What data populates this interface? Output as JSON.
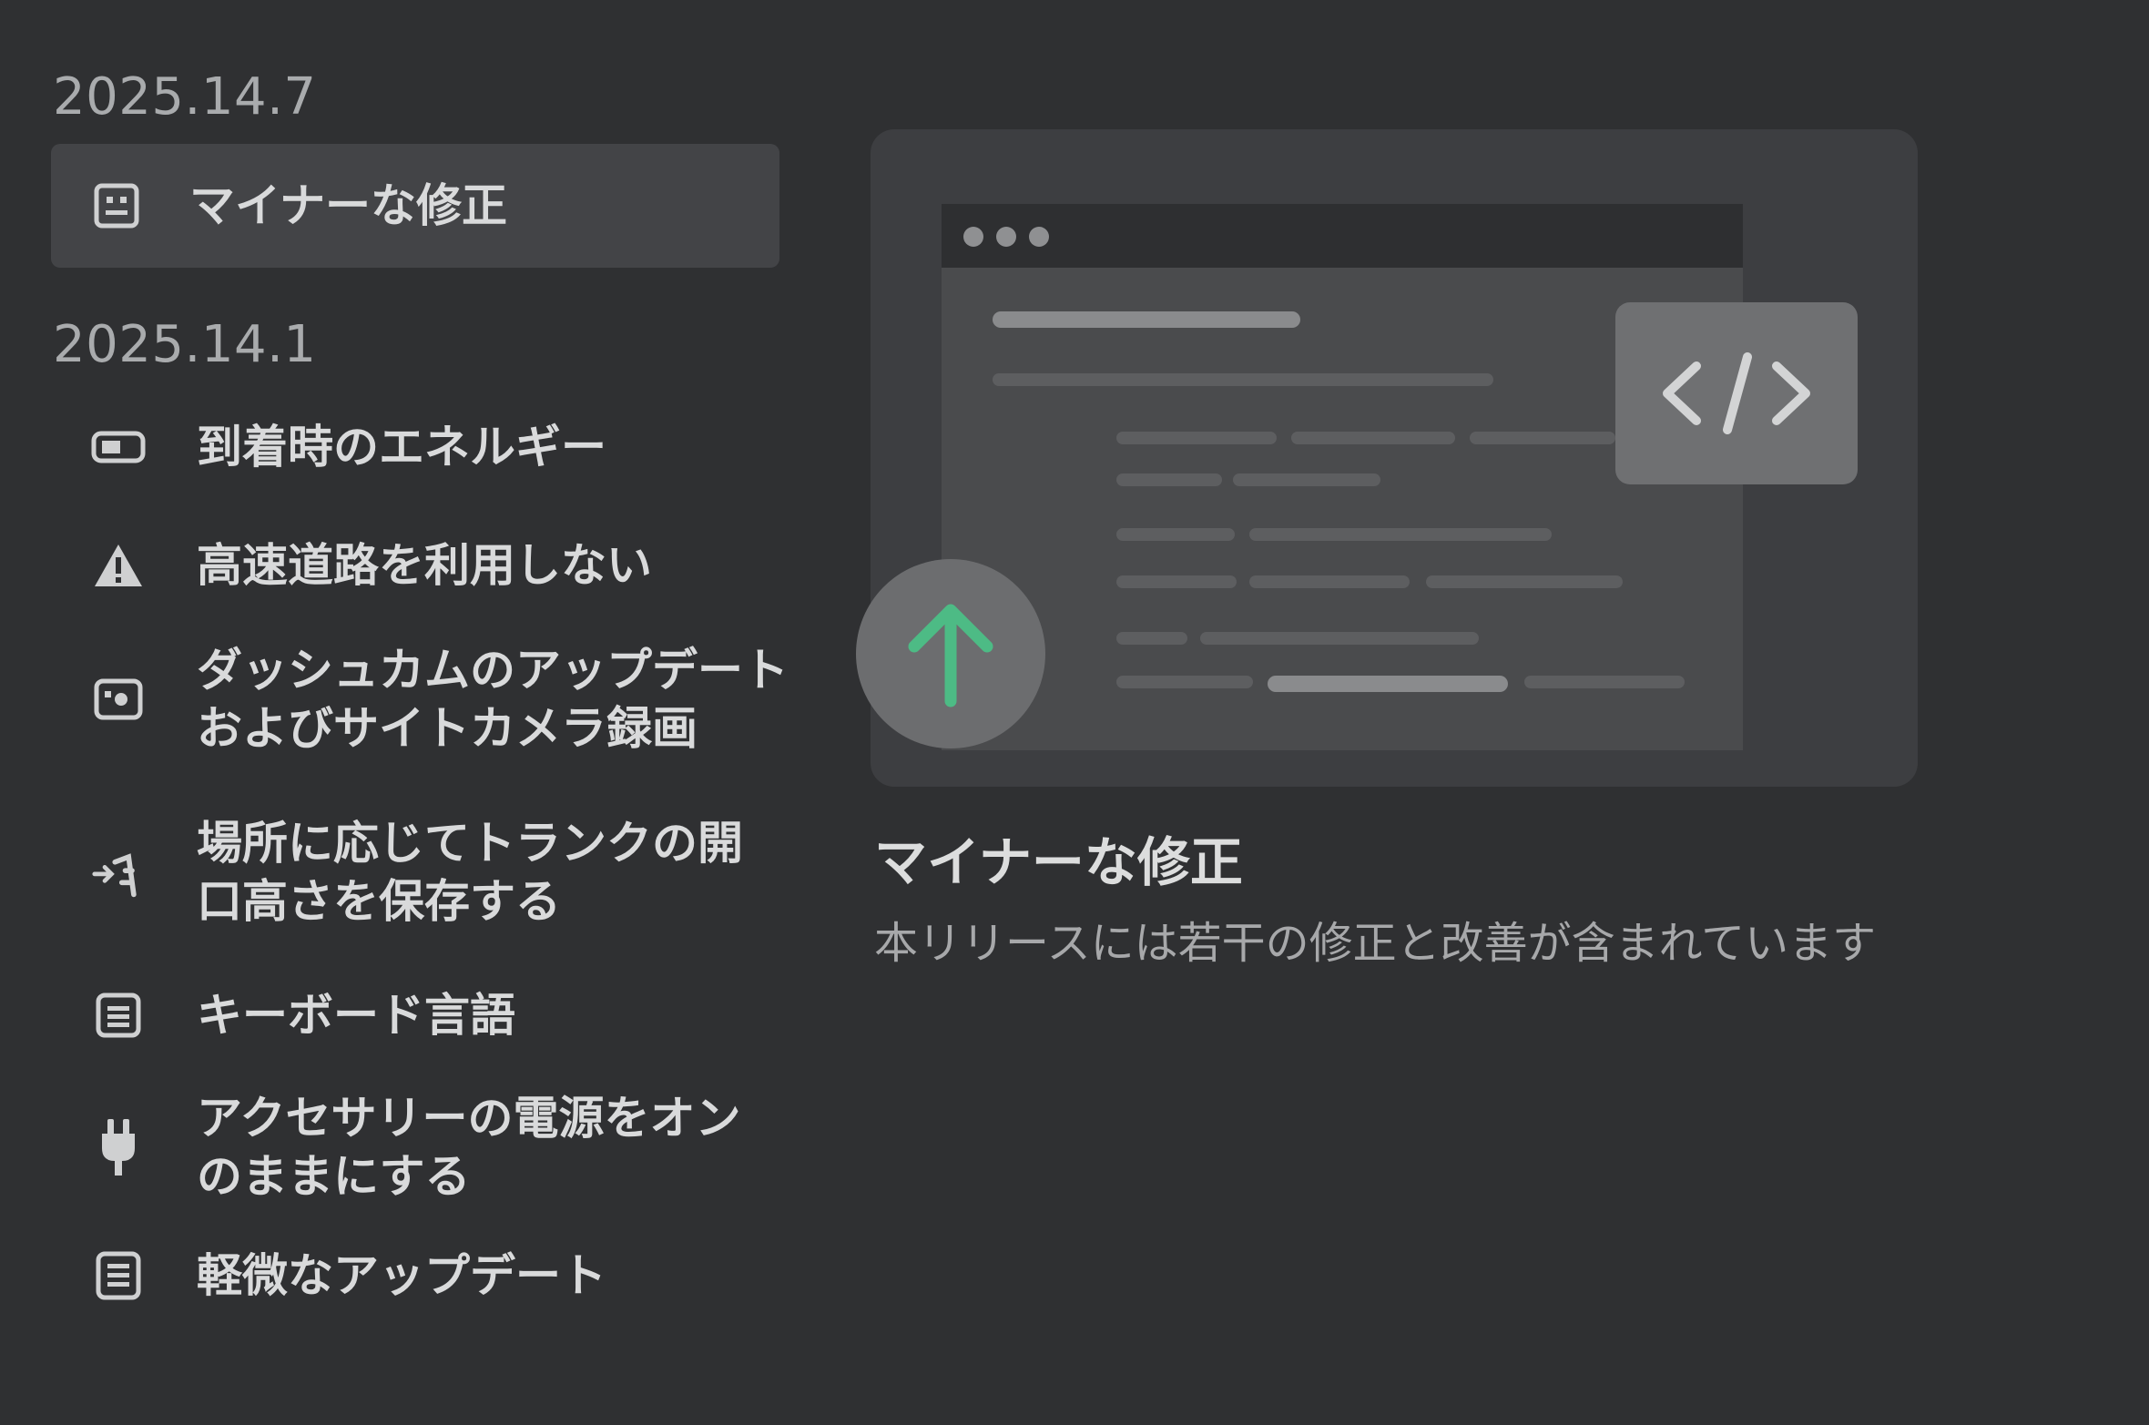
{
  "sidebar": {
    "groups": [
      {
        "version": "2025.14.7",
        "items": [
          {
            "label": "マイナーな修正",
            "icon": "release-notes-icon",
            "selected": true
          }
        ]
      },
      {
        "version": "2025.14.1",
        "items": [
          {
            "label": "到着時のエネルギー",
            "icon": "battery-icon"
          },
          {
            "label": "高速道路を利用しない",
            "icon": "warning-icon"
          },
          {
            "label": "ダッシュカムのアップデート\nおよびサイトカメラ録画",
            "icon": "camera-icon"
          },
          {
            "label": "場所に応じてトランクの開\n口高さを保存する",
            "icon": "trunk-icon"
          },
          {
            "label": "キーボード言語",
            "icon": "keyboard-icon"
          },
          {
            "label": "アクセサリーの電源をオン\nのままにする",
            "icon": "plug-icon"
          },
          {
            "label": "軽微なアップデート",
            "icon": "list-icon"
          }
        ]
      }
    ]
  },
  "detail": {
    "title": "マイナーな修正",
    "description": "本リリースには若干の修正と改善が含まれています",
    "accent_color": "#4dbb85"
  }
}
